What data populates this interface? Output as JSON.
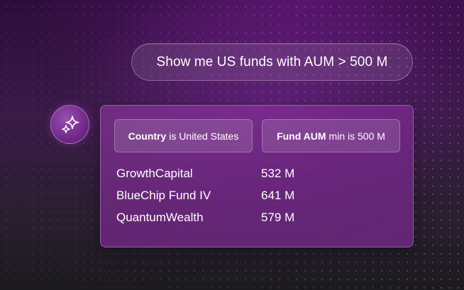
{
  "query": {
    "text": "Show me US funds with AUM > 500 M"
  },
  "assistant": {
    "icon": "sparkle-icon"
  },
  "filters": [
    {
      "field": "Country",
      "condition": "is United States"
    },
    {
      "field": "Fund AUM",
      "condition": "min is 500 M"
    }
  ],
  "results": [
    {
      "name": "GrowthCapital",
      "aum": "532 M"
    },
    {
      "name": "BlueChip Fund IV",
      "aum": "641 M"
    },
    {
      "name": "QuantumWealth",
      "aum": "579 M"
    }
  ],
  "colors": {
    "accent": "#7a2d93",
    "background": "#2c0d3a"
  }
}
